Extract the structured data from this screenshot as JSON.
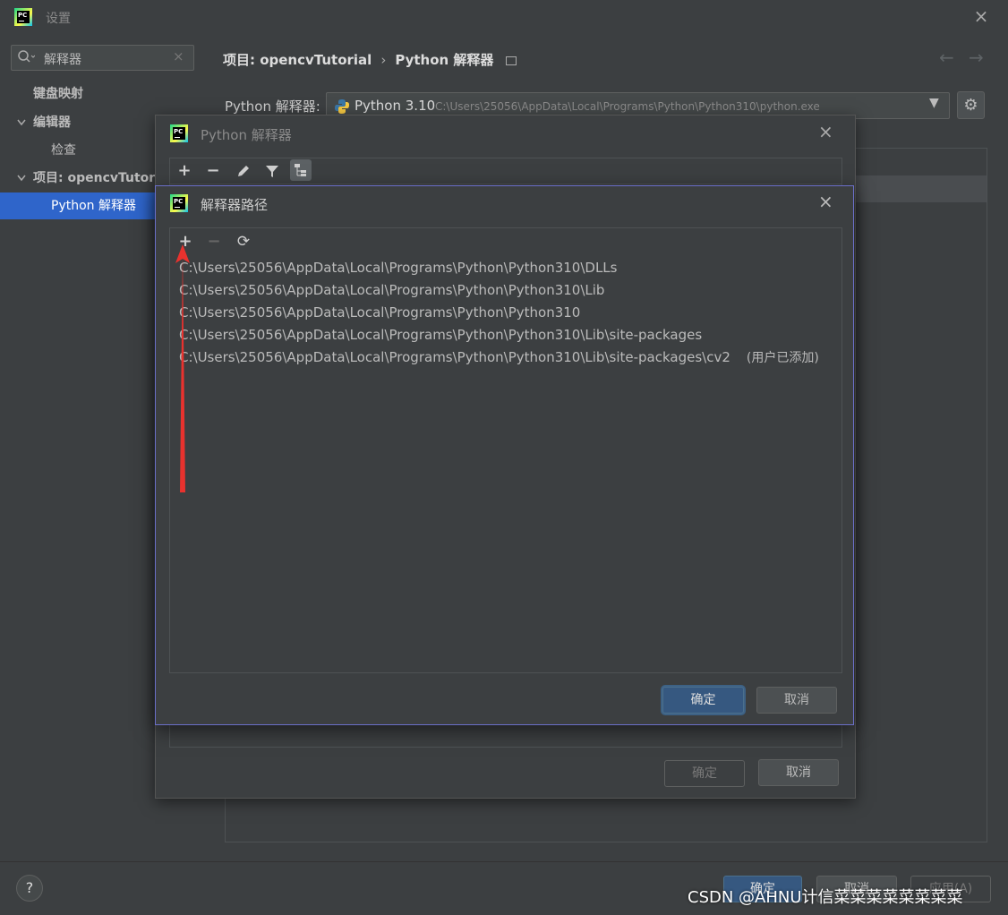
{
  "window": {
    "title": "设置",
    "close_icon": "×"
  },
  "sidebar": {
    "search": {
      "value": "解释器",
      "clear_icon": "×"
    },
    "items": [
      {
        "label": "键盘映射"
      },
      {
        "label": "编辑器",
        "expanded": true
      },
      {
        "label": "检查"
      },
      {
        "label": "项目: opencvTutor",
        "expanded": true
      },
      {
        "label": "Python 解释器",
        "selected": true
      }
    ]
  },
  "main": {
    "breadcrumb": {
      "project": "项目: opencvTutorial",
      "separator": "›",
      "page": "Python 解释器"
    },
    "nav": {
      "back": "←",
      "forward": "→"
    },
    "interpreter": {
      "label": "Python 解释器:",
      "name": "Python 3.10",
      "path": "C:\\Users\\25056\\AppData\\Local\\Programs\\Python\\Python310\\python.exe",
      "dropdown_icon": "▼",
      "gear_icon": "⚙"
    }
  },
  "footer": {
    "help": "?",
    "ok": "确定",
    "cancel": "取消",
    "apply": "应用(A)"
  },
  "dialog_interpreters": {
    "title": "Python 解释器",
    "close_icon": "×",
    "toolbar": {
      "add": "+",
      "remove": "−",
      "edit": "✎",
      "filter": "▼",
      "tree": "⊞"
    },
    "ok": "确定",
    "cancel": "取消"
  },
  "dialog_paths": {
    "title": "解释器路径",
    "close_icon": "×",
    "toolbar": {
      "add": "+",
      "remove": "−",
      "refresh": "⟳"
    },
    "paths": [
      {
        "text": "C:\\Users\\25056\\AppData\\Local\\Programs\\Python\\Python310\\DLLs",
        "tag": ""
      },
      {
        "text": "C:\\Users\\25056\\AppData\\Local\\Programs\\Python\\Python310\\Lib",
        "tag": ""
      },
      {
        "text": "C:\\Users\\25056\\AppData\\Local\\Programs\\Python\\Python310",
        "tag": ""
      },
      {
        "text": "C:\\Users\\25056\\AppData\\Local\\Programs\\Python\\Python310\\Lib\\site-packages",
        "tag": ""
      },
      {
        "text": "C:\\Users\\25056\\AppData\\Local\\Programs\\Python\\Python310\\Lib\\site-packages\\cv2",
        "tag": "(用户已添加)"
      }
    ],
    "ok": "确定",
    "cancel": "取消"
  },
  "annotation": {
    "arrow_color": "#e8322e"
  },
  "watermark": "CSDN @AHNU计信菜菜菜菜菜菜菜菜"
}
